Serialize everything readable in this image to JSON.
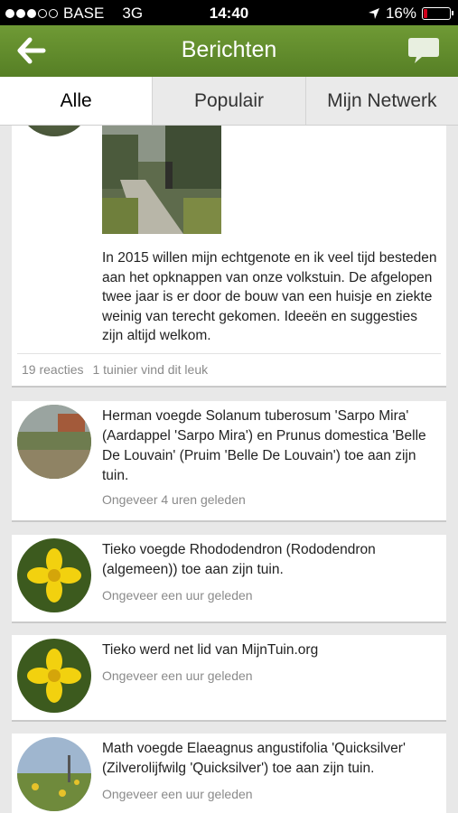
{
  "status": {
    "carrier": "BASE",
    "network": "3G",
    "time": "14:40",
    "battery": "16%",
    "battery_level": 0.16
  },
  "nav": {
    "title": "Berichten"
  },
  "tabs": [
    {
      "label": "Alle",
      "active": true
    },
    {
      "label": "Populair",
      "active": false
    },
    {
      "label": "Mijn Netwerk",
      "active": false
    }
  ],
  "post": {
    "text": "In 2015 willen mijn echtgenote en ik veel tijd besteden aan het opknappen van onze volkstuin. De afgelopen twee jaar is er door de bouw van een huisje en ziekte weinig van terecht gekomen. Ideeën en suggesties zijn altijd welkom.",
    "reactions": "19 reacties",
    "likes": "1 tuinier vind dit leuk"
  },
  "activities": [
    {
      "text": "Herman voegde Solanum tuberosum 'Sarpo Mira' (Aardappel 'Sarpo Mira') en Prunus domestica 'Belle De Louvain' (Pruim 'Belle De Louvain') toe aan zijn tuin.",
      "time": "Ongeveer 4 uren geleden"
    },
    {
      "text": "Tieko voegde Rhododendron (Rododendron (algemeen)) toe aan zijn tuin.",
      "time": "Ongeveer een uur geleden"
    },
    {
      "text": "Tieko werd net lid van MijnTuin.org",
      "time": "Ongeveer een uur geleden"
    },
    {
      "text": "Math voegde Elaeagnus angustifolia 'Quicksilver' (Zilverolijfwilg 'Quicksilver') toe aan zijn tuin.",
      "time": "Ongeveer een uur geleden"
    }
  ]
}
